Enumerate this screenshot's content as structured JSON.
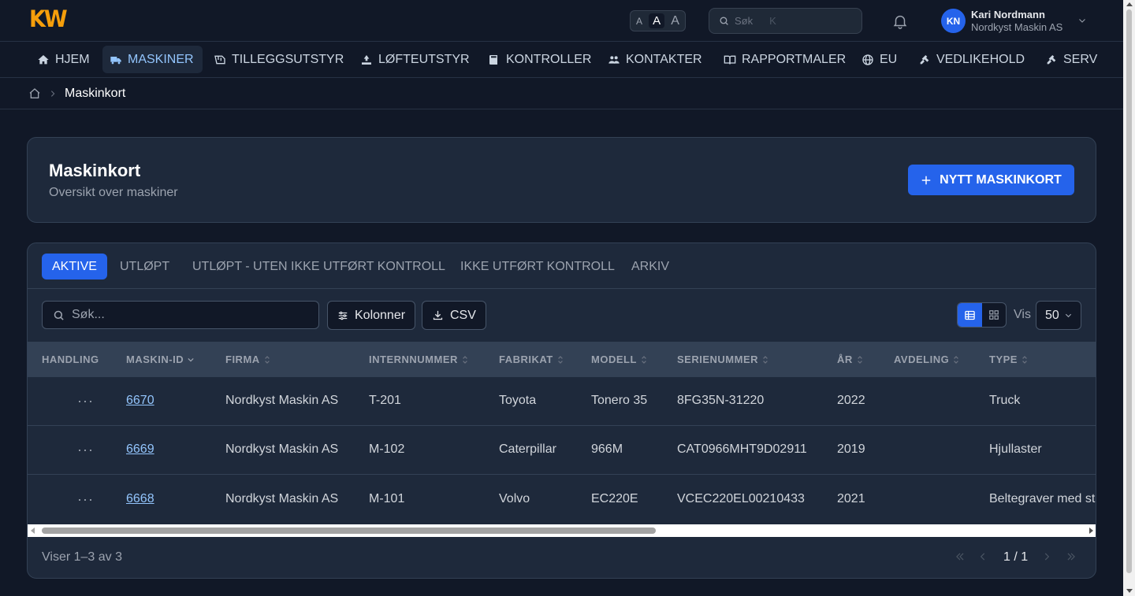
{
  "app": {
    "logo": "KW"
  },
  "topbar": {
    "font_sizes": [
      "A",
      "A",
      "A"
    ],
    "search": {
      "placeholder": "Søk",
      "shortcut": "K"
    },
    "user": {
      "initials": "KN",
      "name": "Kari Nordmann",
      "org": "Nordkyst Maskin AS"
    }
  },
  "nav": {
    "items": [
      {
        "label": "HJEM",
        "icon": "home-icon"
      },
      {
        "label": "MASKINER",
        "icon": "truck-icon",
        "active": true
      },
      {
        "label": "TILLEGGSUTSTYR",
        "icon": "attachment-icon"
      },
      {
        "label": "LØFTEUTSTYR",
        "icon": "lift-icon"
      },
      {
        "label": "KONTROLLER",
        "icon": "book-icon"
      },
      {
        "label": "KONTAKTER",
        "icon": "users-icon"
      },
      {
        "label": "RAPPORTMALER",
        "icon": "open-book-icon"
      },
      {
        "label": "EU",
        "icon": "globe-icon"
      },
      {
        "label": "VEDLIKEHOLD",
        "icon": "tools-icon"
      },
      {
        "label": "SERV",
        "icon": "tools-icon"
      }
    ]
  },
  "breadcrumb": {
    "current": "Maskinkort"
  },
  "header": {
    "title": "Maskinkort",
    "subtitle": "Oversikt over maskiner",
    "new_button": "NYTT MASKINKORT"
  },
  "tabs": [
    "AKTIVE",
    "UTLØPT",
    "UTLØPT - UTEN IKKE UTFØRT KONTROLL",
    "IKKE UTFØRT KONTROLL",
    "ARKIV"
  ],
  "toolbar": {
    "search_placeholder": "Søk...",
    "columns_label": "Kolonner",
    "csv_label": "CSV",
    "show_label": "Vis",
    "page_size": "50"
  },
  "table": {
    "columns": [
      "HANDLING",
      "MASKIN-ID",
      "FIRMA",
      "INTERNNUMMER",
      "FABRIKAT",
      "MODELL",
      "SERIENUMMER",
      "ÅR",
      "AVDELING",
      "TYPE"
    ],
    "rows": [
      {
        "id": "6670",
        "firma": "Nordkyst Maskin AS",
        "intern": "T-201",
        "fabrikat": "Toyota",
        "modell": "Tonero 35",
        "serie": "8FG35N-31220",
        "ar": "2022",
        "avdeling": "",
        "type": "Truck"
      },
      {
        "id": "6669",
        "firma": "Nordkyst Maskin AS",
        "intern": "M-102",
        "fabrikat": "Caterpillar",
        "modell": "966M",
        "serie": "CAT0966MHT9D02911",
        "ar": "2019",
        "avdeling": "",
        "type": "Hjullaster"
      },
      {
        "id": "6668",
        "firma": "Nordkyst Maskin AS",
        "intern": "M-101",
        "fabrikat": "Volvo",
        "modell": "EC220E",
        "serie": "VCEC220EL00210433",
        "ar": "2021",
        "avdeling": "",
        "type": "Beltegraver med st"
      }
    ]
  },
  "footer": {
    "count": "Viser 1–3 av 3",
    "page": "1 / 1"
  },
  "colors": {
    "accent": "#2563eb",
    "logo": "#f59e0b",
    "link": "#93c5fd",
    "background": "#111827",
    "card": "#1e293b"
  }
}
